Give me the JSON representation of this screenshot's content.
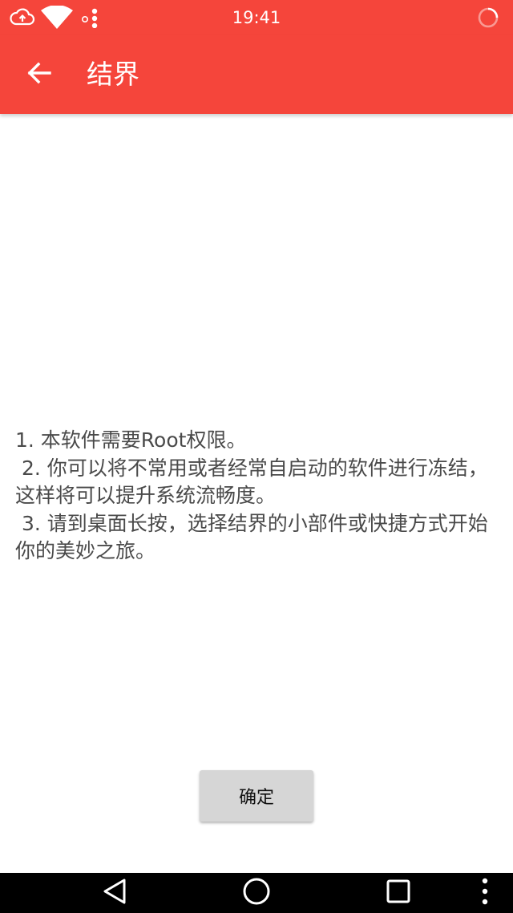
{
  "status_bar": {
    "time": "19:41",
    "icons": [
      "cloud-upload-icon",
      "wifi-icon",
      "notification-dots-icon",
      "loading-spinner-icon"
    ]
  },
  "app_bar": {
    "title": "结界",
    "back_icon": "arrow-back-icon"
  },
  "content": {
    "text": "1. 本软件需要Root权限。\n 2. 你可以将不常用或者经常自启动的软件进行冻结，这样将可以提升系统流畅度。\n 3. 请到桌面长按，选择结界的小部件或快捷方式开始你的美妙之旅。"
  },
  "dialog": {
    "confirm_label": "确定"
  },
  "nav_bar": {
    "icons": [
      "back-triangle-icon",
      "home-circle-icon",
      "recents-square-icon",
      "more-vert-icon"
    ]
  },
  "colors": {
    "primary": "#f5453b",
    "text": "#4a4a4a",
    "button": "#d6d6d6"
  }
}
